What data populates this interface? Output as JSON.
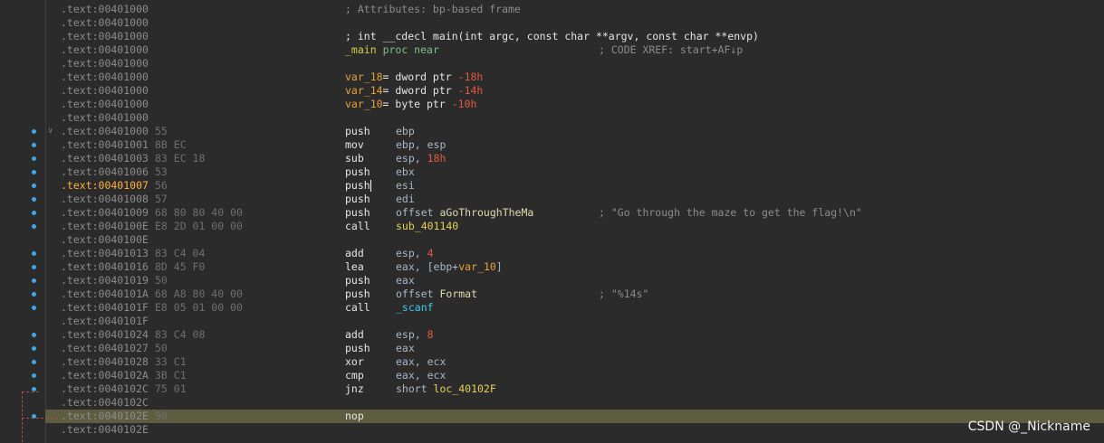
{
  "listing": {
    "lines": [
      {
        "addr": ".text:00401000",
        "comment_only": "; Attributes: bp-based frame"
      },
      {
        "addr": ".text:00401000"
      },
      {
        "addr": ".text:00401000",
        "proto": "; int __cdecl main(int argc, const char **argv, const char **envp)"
      },
      {
        "addr": ".text:00401000",
        "proc_name": "_main",
        "proc_kw": "proc near",
        "xref": "; CODE XREF: start+AF↓p"
      },
      {
        "addr": ".text:00401000"
      },
      {
        "addr": ".text:00401000",
        "var_name": "var_18",
        "var_rest": "= dword ptr ",
        "var_off": "-18h"
      },
      {
        "addr": ".text:00401000",
        "var_name": "var_14",
        "var_rest": "= dword ptr ",
        "var_off": "-14h"
      },
      {
        "addr": ".text:00401000",
        "var_name": "var_10",
        "var_rest": "= byte ptr ",
        "var_off": "-10h"
      },
      {
        "addr": ".text:00401000"
      },
      {
        "addr": ".text:00401000",
        "hex": "55",
        "mnem": "push",
        "op": "ebp"
      },
      {
        "addr": ".text:00401001",
        "hex": "8B EC",
        "mnem": "mov",
        "op": "ebp, esp"
      },
      {
        "addr": ".text:00401003",
        "hex": "83 EC 18",
        "mnem": "sub",
        "op": "esp, ",
        "op_num": "18h"
      },
      {
        "addr": ".text:00401006",
        "hex": "53",
        "mnem": "push",
        "op": "ebx"
      },
      {
        "addr": ".text:00401007",
        "hex": "56",
        "mnem": "push",
        "op": "esi"
      },
      {
        "addr": ".text:00401008",
        "hex": "57",
        "mnem": "push",
        "op": "edi"
      },
      {
        "addr": ".text:00401009",
        "hex": "68 80 80 40 00",
        "mnem": "push",
        "op": "offset ",
        "op_sym": "aGoThroughTheMa",
        "comment": "; \"Go through the maze to get the flag!\\n\""
      },
      {
        "addr": ".text:0040100E",
        "hex": "E8 2D 01 00 00",
        "mnem": "call",
        "op_call": "sub_401140"
      },
      {
        "addr": ".text:0040100E"
      },
      {
        "addr": ".text:00401013",
        "hex": "83 C4 04",
        "mnem": "add",
        "op": "esp, ",
        "op_num": "4"
      },
      {
        "addr": ".text:00401016",
        "hex": "8D 45 F0",
        "mnem": "lea",
        "op": "eax, [ebp+",
        "op_var": "var_10",
        "op_tail": "]"
      },
      {
        "addr": ".text:00401019",
        "hex": "50",
        "mnem": "push",
        "op": "eax"
      },
      {
        "addr": ".text:0040101A",
        "hex": "68 A8 80 40 00",
        "mnem": "push",
        "op": "offset ",
        "op_sym": "Format",
        "comment": "; \"%14s\""
      },
      {
        "addr": ".text:0040101F",
        "hex": "E8 05 01 00 00",
        "mnem": "call",
        "op_imp": "_scanf"
      },
      {
        "addr": ".text:0040101F"
      },
      {
        "addr": ".text:00401024",
        "hex": "83 C4 08",
        "mnem": "add",
        "op": "esp, ",
        "op_num": "8"
      },
      {
        "addr": ".text:00401027",
        "hex": "50",
        "mnem": "push",
        "op": "eax"
      },
      {
        "addr": ".text:00401028",
        "hex": "33 C1",
        "mnem": "xor",
        "op": "eax, ecx"
      },
      {
        "addr": ".text:0040102A",
        "hex": "3B C1",
        "mnem": "cmp",
        "op": "eax, ecx"
      },
      {
        "addr": ".text:0040102C",
        "hex": "75 01",
        "mnem": "jnz",
        "op": "short ",
        "op_call": "loc_40102F"
      },
      {
        "addr": ".text:0040102C"
      },
      {
        "addr": ".text:0040102E",
        "hex": "90",
        "mnem": "nop"
      },
      {
        "addr": ".text:0040102E"
      }
    ]
  },
  "colors": {
    "background": "#2b2b2b",
    "highlight_row": "#5e5d41",
    "breakpoint_dot": "#41a6e6",
    "current_address": "#ffb23f"
  },
  "watermark": "CSDN @_Nickname"
}
